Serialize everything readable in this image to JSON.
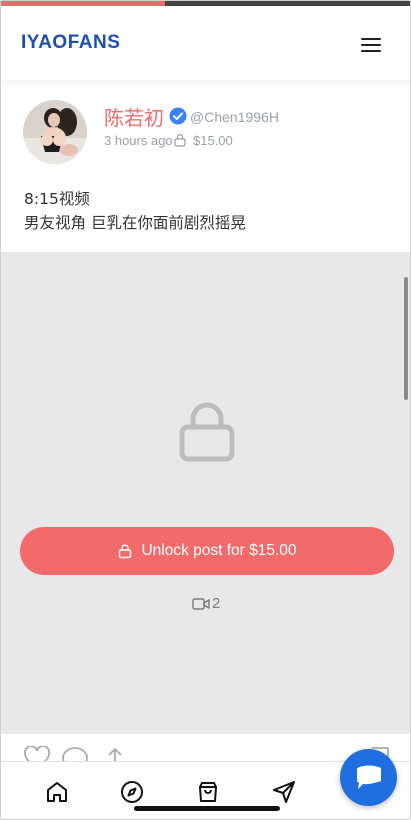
{
  "header": {
    "logo": "IYAOFANS",
    "menu_icon": "hamburger-menu-icon"
  },
  "load_progress": 0.4,
  "post": {
    "author_name": "陈若初",
    "verified": true,
    "handle": "@Chen1996H",
    "time_ago": "3 hours ago",
    "price": "$15.00",
    "text_line1": "8:15视频",
    "text_line2": "男友视角 巨乳在你面前剧烈摇晃"
  },
  "media": {
    "locked_icon": "lock-icon",
    "unlock_label": "Unlock post for $15.00",
    "video_count": "2"
  },
  "actions": [
    "heart-icon",
    "comment-icon",
    "share-icon",
    "bookmark-icon"
  ],
  "tabbar": [
    "home-icon",
    "compass-icon",
    "shopping-bag-icon",
    "send-icon"
  ],
  "colors": {
    "accent": "#f06b6b",
    "brand": "#1e4fb0",
    "fab": "#1f6fe0"
  }
}
